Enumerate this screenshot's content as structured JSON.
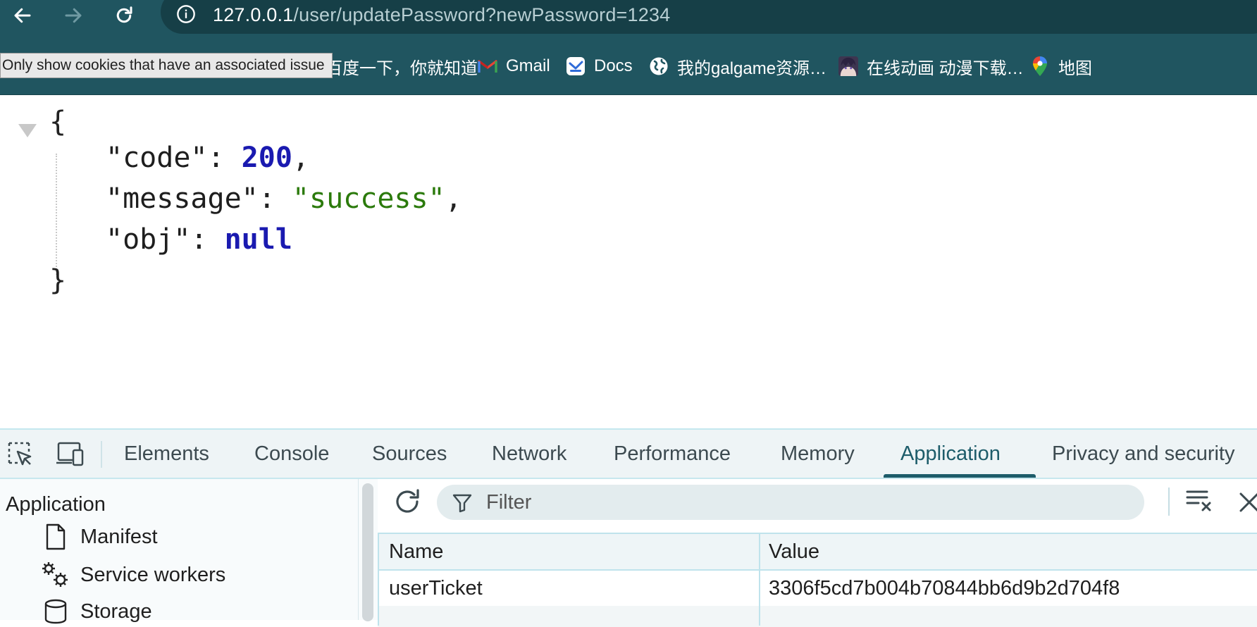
{
  "browser": {
    "url_host": "127.0.0.1",
    "url_path": "/user/updatePassword?newPassword=1234",
    "tooltip": "Only show cookies that have an associated issue",
    "bookmarks": [
      {
        "label": "百度一下，你就知道",
        "icon": "baidu-icon"
      },
      {
        "label": "Gmail",
        "icon": "gmail-icon"
      },
      {
        "label": "Docs",
        "icon": "docs-icon"
      },
      {
        "label": "我的galgame资源…",
        "icon": "globe-icon"
      },
      {
        "label": "在线动画 动漫下载…",
        "icon": "anime-avatar-icon"
      },
      {
        "label": "地图",
        "icon": "maps-pin-icon"
      }
    ]
  },
  "json_response": {
    "open_brace": "{",
    "close_brace": "}",
    "code_key": "\"code\"",
    "code_value": "200",
    "message_key": "\"message\"",
    "message_value": "\"success\"",
    "obj_key": "\"obj\"",
    "obj_value": "null",
    "colon": ": ",
    "comma": ","
  },
  "devtools": {
    "tabs": [
      "Elements",
      "Console",
      "Sources",
      "Network",
      "Performance",
      "Memory",
      "Application",
      "Privacy and security"
    ],
    "active_tab": "Application",
    "sidebar": {
      "title": "Application",
      "items": [
        {
          "label": "Manifest",
          "icon": "file-icon"
        },
        {
          "label": "Service workers",
          "icon": "gears-icon"
        },
        {
          "label": "Storage",
          "icon": "database-icon"
        }
      ]
    },
    "filter_placeholder": "Filter",
    "table": {
      "headers": [
        "Name",
        "Value"
      ],
      "rows": [
        {
          "name": "userTicket",
          "value": "3306f5cd7b004b70844bb6d9b2d704f8"
        }
      ]
    }
  },
  "colors": {
    "chrome_bg": "#205560",
    "accent": "#1d5c6a",
    "json_number": "#1a1ab0",
    "json_string": "#2b7a0b"
  }
}
